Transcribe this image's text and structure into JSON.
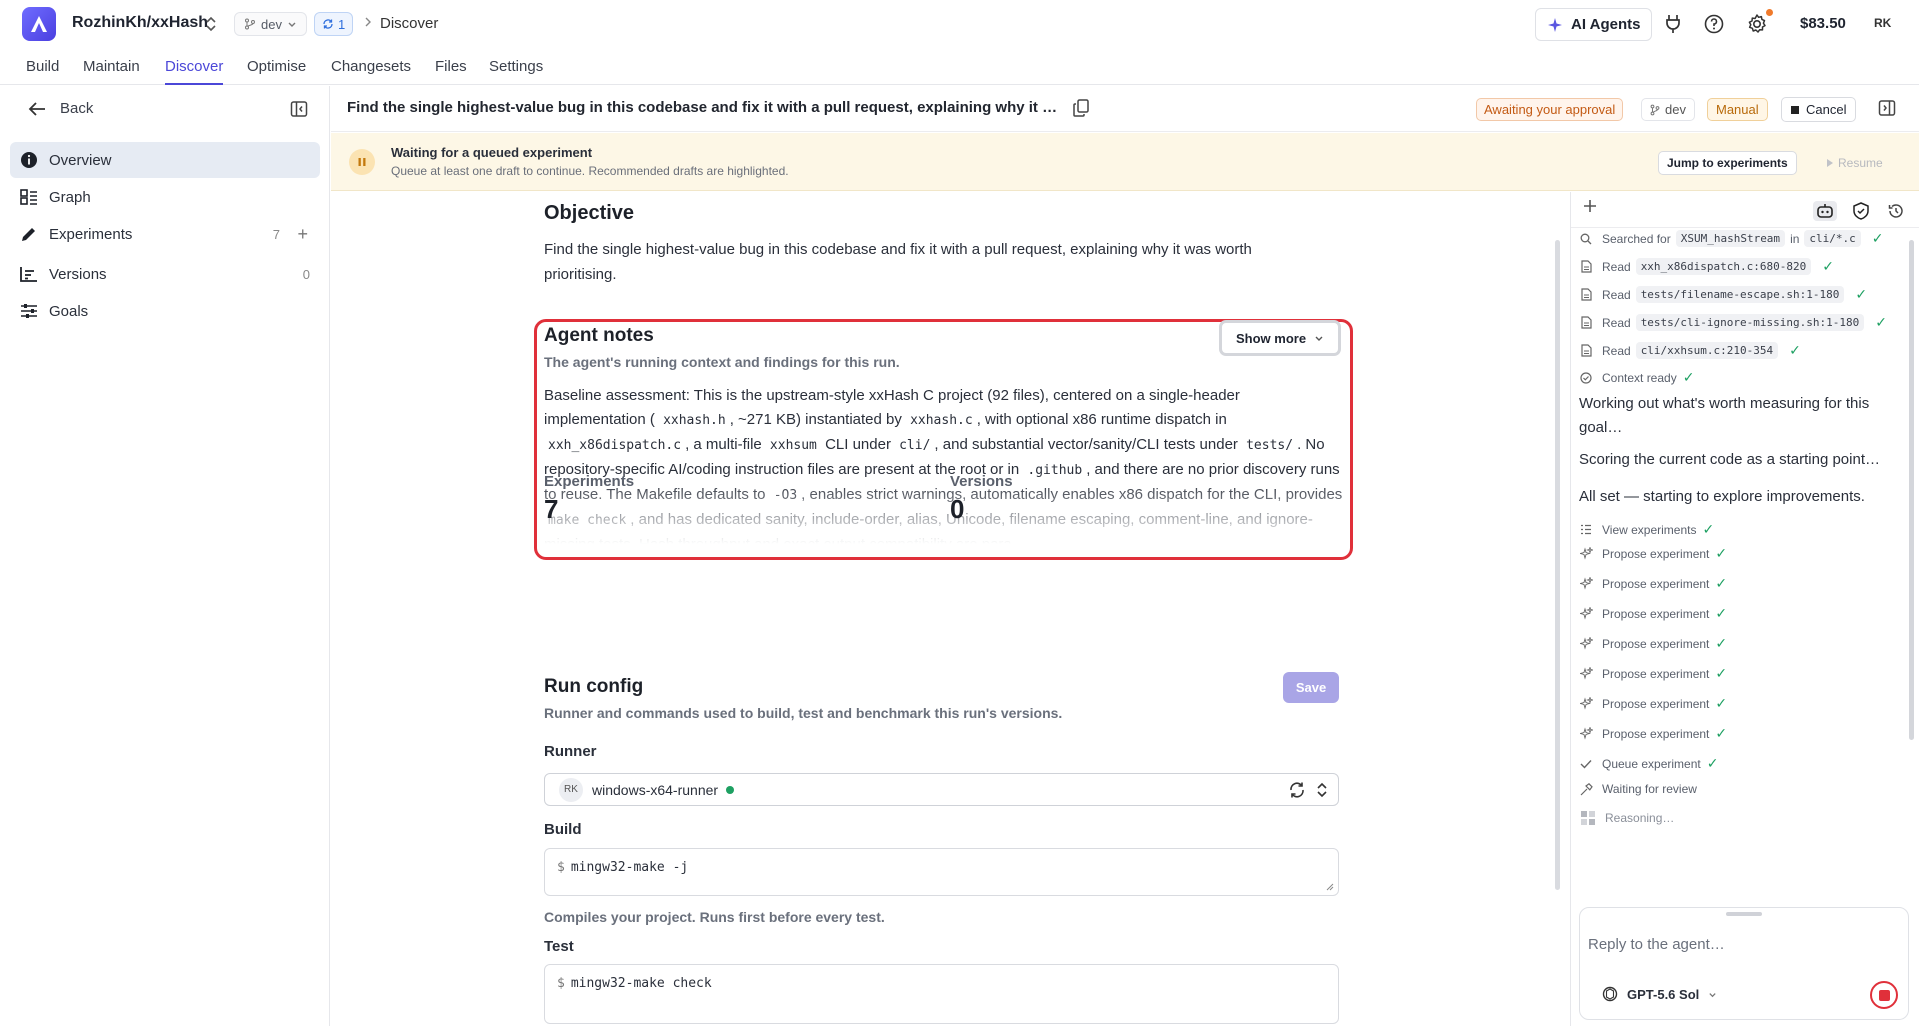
{
  "topbar": {
    "repo": "RozhinKh/xxHash",
    "branch": "dev",
    "sync_count": "1",
    "crumb": "Discover",
    "ai_agents_label": "AI Agents",
    "balance": "$83.50",
    "avatar": "RK"
  },
  "tabs": [
    {
      "label": "Build"
    },
    {
      "label": "Maintain"
    },
    {
      "label": "Discover"
    },
    {
      "label": "Optimise"
    },
    {
      "label": "Changesets"
    },
    {
      "label": "Files"
    },
    {
      "label": "Settings"
    }
  ],
  "sidebar": {
    "back_label": "Back",
    "items": [
      {
        "label": "Overview"
      },
      {
        "label": "Graph"
      },
      {
        "label": "Experiments",
        "count": "7",
        "plus": "+"
      },
      {
        "label": "Versions",
        "count": "0"
      },
      {
        "label": "Goals"
      }
    ]
  },
  "header": {
    "title": "Find the single highest-value bug in this codebase and fix it with a pull request, explaining why it was worth prioritising.",
    "status": "Awaiting your approval",
    "branch": "dev",
    "mode": "Manual",
    "cancel_label": "Cancel"
  },
  "banner": {
    "title": "Waiting for a queued experiment",
    "subtitle": "Queue at least one draft to continue. Recommended drafts are highlighted.",
    "jump_label": "Jump to experiments",
    "resume_label": "Resume"
  },
  "objective": {
    "heading": "Objective",
    "text": "Find the single highest-value bug in this codebase and fix it with a pull request, explaining why it was worth prioritising."
  },
  "notes": {
    "heading": "Agent notes",
    "subtitle": "The agent's running context and findings for this run.",
    "show_more_label": "Show more",
    "t1": "Baseline assessment: This is the upstream-style xxHash C project (92 files), centered on a single-header implementation (",
    "c1": "xxhash.h",
    "t2": ", ~271 KB) instantiated by",
    "c2": "xxhash.c",
    "t3": ", with optional x86 runtime dispatch in",
    "c3": "xxh_x86dispatch.c",
    "t4": ", a multi-file",
    "c4": "xxhsum",
    "t5": "CLI under",
    "c5": "cli/",
    "t6": ", and substantial vector/sanity/CLI tests under",
    "c6": "tests/",
    "t7": ". No repository-specific AI/coding instruction files are present at the root or in",
    "c7": ".github",
    "t8": ", and there are no prior discovery runs to reuse. The Makefile defaults to",
    "c8": "-O3",
    "t9": ", enables strict warnings, automatically enables x86 dispatch for the CLI, provides",
    "c9": "make check",
    "t10": ", and has dedicated sanity, include-order, alias, Unicode, filename escaping, comment-line, and ignore-missing tests. Hash throughput and exact output compatibility are para..."
  },
  "stats": {
    "experiments_label": "Experiments",
    "experiments_value": "7",
    "versions_label": "Versions",
    "versions_value": "0"
  },
  "run_config": {
    "heading": "Run config",
    "subtitle": "Runner and commands used to build, test and benchmark this run's versions.",
    "save_label": "Save",
    "runner_label": "Runner",
    "runner_avatar": "RK",
    "runner_name": "windows-x64-runner",
    "build_label": "Build",
    "build_cmd": "mingw32-make -j",
    "build_help": "Compiles your project. Runs first before every test.",
    "test_label": "Test",
    "test_cmd": "mingw32-make check",
    "prompt": "$"
  },
  "activity": {
    "searched": {
      "label": "Searched for",
      "query": "XSUM_hashStream",
      "in": "in",
      "scope": "cli/*.c"
    },
    "reads": [
      {
        "label": "Read",
        "file": "xxh_x86dispatch.c:680-820"
      },
      {
        "label": "Read",
        "file": "tests/filename-escape.sh:1-180"
      },
      {
        "label": "Read",
        "file": "tests/cli-ignore-missing.sh:1-180"
      },
      {
        "label": "Read",
        "file": "cli/xxhsum.c:210-354"
      }
    ],
    "context_ready": "Context ready",
    "msg1": "Working out what's worth measuring for this goal…",
    "msg2": "Scoring the current code as a starting point…",
    "msg3": "All set — starting to explore improvements.",
    "view_experiments": "View experiments",
    "proposes": [
      "Propose experiment",
      "Propose experiment",
      "Propose experiment",
      "Propose experiment",
      "Propose experiment",
      "Propose experiment",
      "Propose experiment"
    ],
    "queue": "Queue experiment",
    "waiting": "Waiting for review",
    "reasoning": "Reasoning…"
  },
  "reply": {
    "placeholder": "Reply to the agent…",
    "model": "GPT-5.6 Sol"
  }
}
